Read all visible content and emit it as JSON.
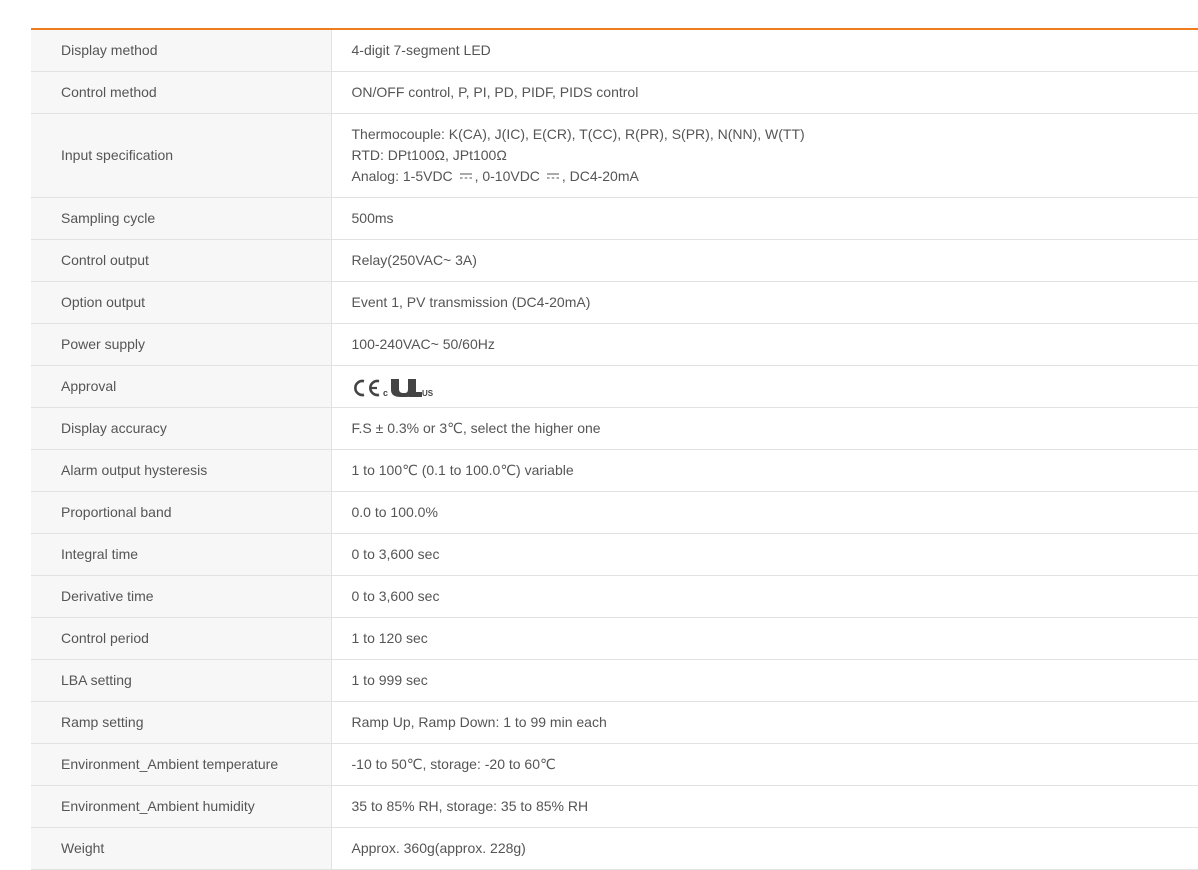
{
  "specs": [
    {
      "label": "Display method",
      "value": "4-digit 7-segment LED"
    },
    {
      "label": "Control method",
      "value": "ON/OFF control, P, PI, PD, PIDF, PIDS control"
    },
    {
      "label": "Input specification",
      "lines": [
        "Thermocouple: K(CA), J(IC), E(CR), T(CC), R(PR), S(PR), N(NN), W(TT)",
        "RTD: DPt100Ω, JPt100Ω"
      ],
      "analog": {
        "prefix": "Analog: 1-5VDC",
        "middle": ", 0-10VDC",
        "suffix": ", DC4-20mA"
      }
    },
    {
      "label": "Sampling cycle",
      "value": "500ms"
    },
    {
      "label": "Control output",
      "value": "Relay(250VAC~ 3A)"
    },
    {
      "label": "Option output",
      "value": "Event 1, PV transmission (DC4-20mA)"
    },
    {
      "label": "Power supply",
      "value": "100-240VAC~ 50/60Hz"
    },
    {
      "label": "Approval",
      "marks": [
        "CE",
        "cULus"
      ],
      "ul_prefix": "c",
      "ul_suffix": "US"
    },
    {
      "label": "Display accuracy",
      "value": "F.S ± 0.3% or 3℃, select the higher one"
    },
    {
      "label": "Alarm output hysteresis",
      "value": "1 to 100℃ (0.1 to 100.0℃) variable"
    },
    {
      "label": "Proportional band",
      "value": "0.0 to 100.0%"
    },
    {
      "label": "Integral time",
      "value": "0 to 3,600 sec"
    },
    {
      "label": "Derivative time",
      "value": "0 to 3,600 sec"
    },
    {
      "label": "Control period",
      "value": "1 to 120 sec"
    },
    {
      "label": "LBA setting",
      "value": "1 to 999 sec"
    },
    {
      "label": "Ramp setting",
      "value": "Ramp Up, Ramp Down: 1 to 99 min each"
    },
    {
      "label": "Environment_Ambient temperature",
      "value": "-10 to 50℃, storage: -20 to 60℃"
    },
    {
      "label": "Environment_Ambient humidity",
      "value": "35 to 85% RH, storage: 35 to 85% RH"
    },
    {
      "label": "Weight",
      "value": "Approx. 360g(approx. 228g)"
    }
  ],
  "colors": {
    "accent": "#f07d1d",
    "label_bg": "#f7f7f7",
    "border": "#e2e2e2",
    "text": "#555555"
  },
  "icons": {
    "dc_symbol": "dc-current-icon",
    "ce_mark": "ce-mark-icon",
    "ul_mark": "ul-listed-mark-icon"
  }
}
